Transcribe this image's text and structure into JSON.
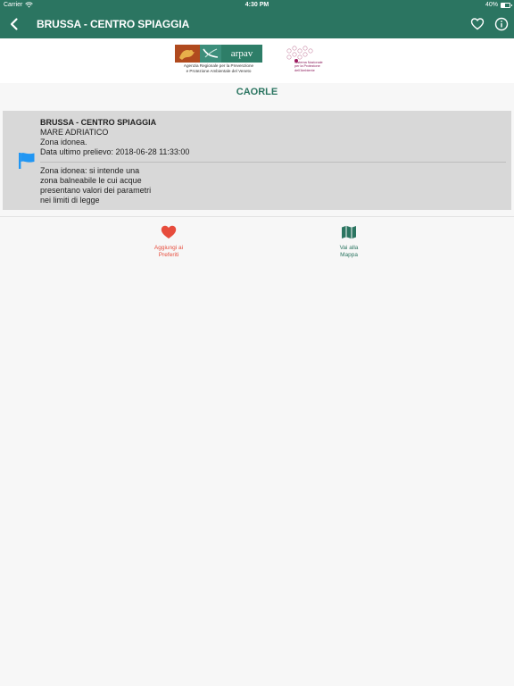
{
  "status_bar": {
    "carrier": "Carrier",
    "time": "4:30 PM",
    "battery": "40%",
    "battery_level": 0.4
  },
  "nav": {
    "title": "BRUSSA - CENTRO SPIAGGIA",
    "back_icon": "chevron-left-icon",
    "favorite_icon": "heart-outline-icon",
    "info_icon": "info-circle-icon"
  },
  "logos": {
    "arpav_name": "arpav",
    "arpav_subtitle_line1": "Agenzia Regionale per la Prevenzione",
    "arpav_subtitle_line2": "e Protezione Ambientale del Veneto",
    "snpa_line1": "Sistema Nazionale",
    "snpa_line2": "per la Protezione",
    "snpa_line3": "dell'Ambiente"
  },
  "city": "CAORLE",
  "card": {
    "name": "BRUSSA - CENTRO SPIAGGIA",
    "sea": "MARE ADRIATICO",
    "status": "Zona idonea.",
    "last_sample": "Data ultimo prelievo: 2018-06-28 11:33:00",
    "description_lines": [
      "Zona idonea: si intende una",
      "zona balneabile le cui acque",
      "presentano valori dei parametri",
      "nei limiti di legge"
    ],
    "flag_color": "#2196f3"
  },
  "actions": {
    "favorites": {
      "line1": "Aggiungi ai",
      "line2": "Preferiti",
      "color": "#e74c3c"
    },
    "map": {
      "line1": "Vai alla",
      "line2": "Mappa",
      "color": "#2b7561"
    }
  },
  "colors": {
    "primary": "#2b7561",
    "card_bg": "#d8d8d8",
    "page_bg": "#f7f7f7"
  }
}
